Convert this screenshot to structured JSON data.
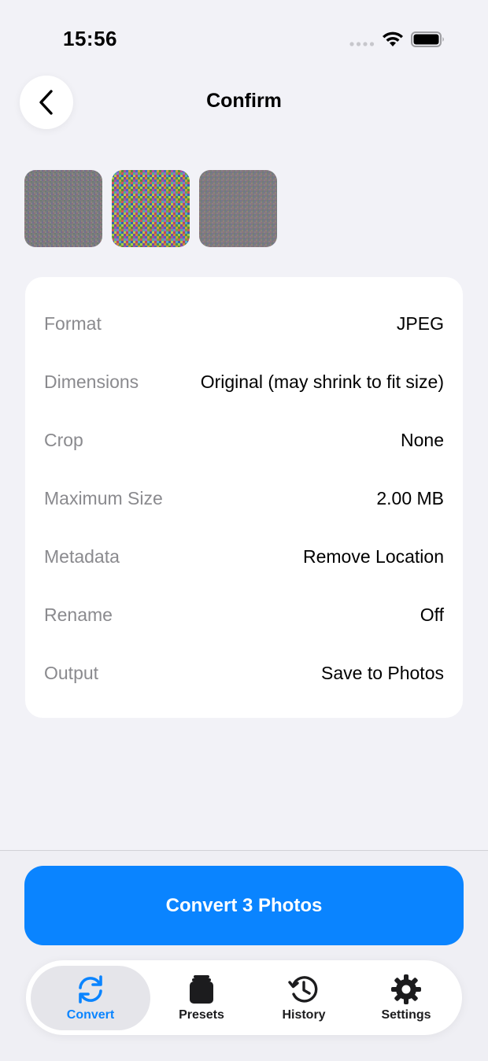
{
  "status_bar": {
    "time": "15:56"
  },
  "nav": {
    "title": "Confirm"
  },
  "thumbnails": [
    {
      "name": "photo-1"
    },
    {
      "name": "photo-2"
    },
    {
      "name": "photo-3"
    }
  ],
  "settings": {
    "rows": [
      {
        "label": "Format",
        "value": "JPEG"
      },
      {
        "label": "Dimensions",
        "value": "Original (may shrink to fit size)"
      },
      {
        "label": "Crop",
        "value": "None"
      },
      {
        "label": "Maximum Size",
        "value": "2.00 MB"
      },
      {
        "label": "Metadata",
        "value": "Remove Location"
      },
      {
        "label": "Rename",
        "value": "Off"
      },
      {
        "label": "Output",
        "value": "Save to Photos"
      }
    ]
  },
  "action": {
    "convert_label": "Convert 3 Photos"
  },
  "tabs": [
    {
      "label": "Convert",
      "icon": "convert-icon",
      "active": true
    },
    {
      "label": "Presets",
      "icon": "presets-icon",
      "active": false
    },
    {
      "label": "History",
      "icon": "history-icon",
      "active": false
    },
    {
      "label": "Settings",
      "icon": "gear-icon",
      "active": false
    }
  ],
  "colors": {
    "accent": "#0a84ff",
    "background": "#f2f2f7",
    "card": "#ffffff",
    "label_gray": "#8a8a8e"
  }
}
